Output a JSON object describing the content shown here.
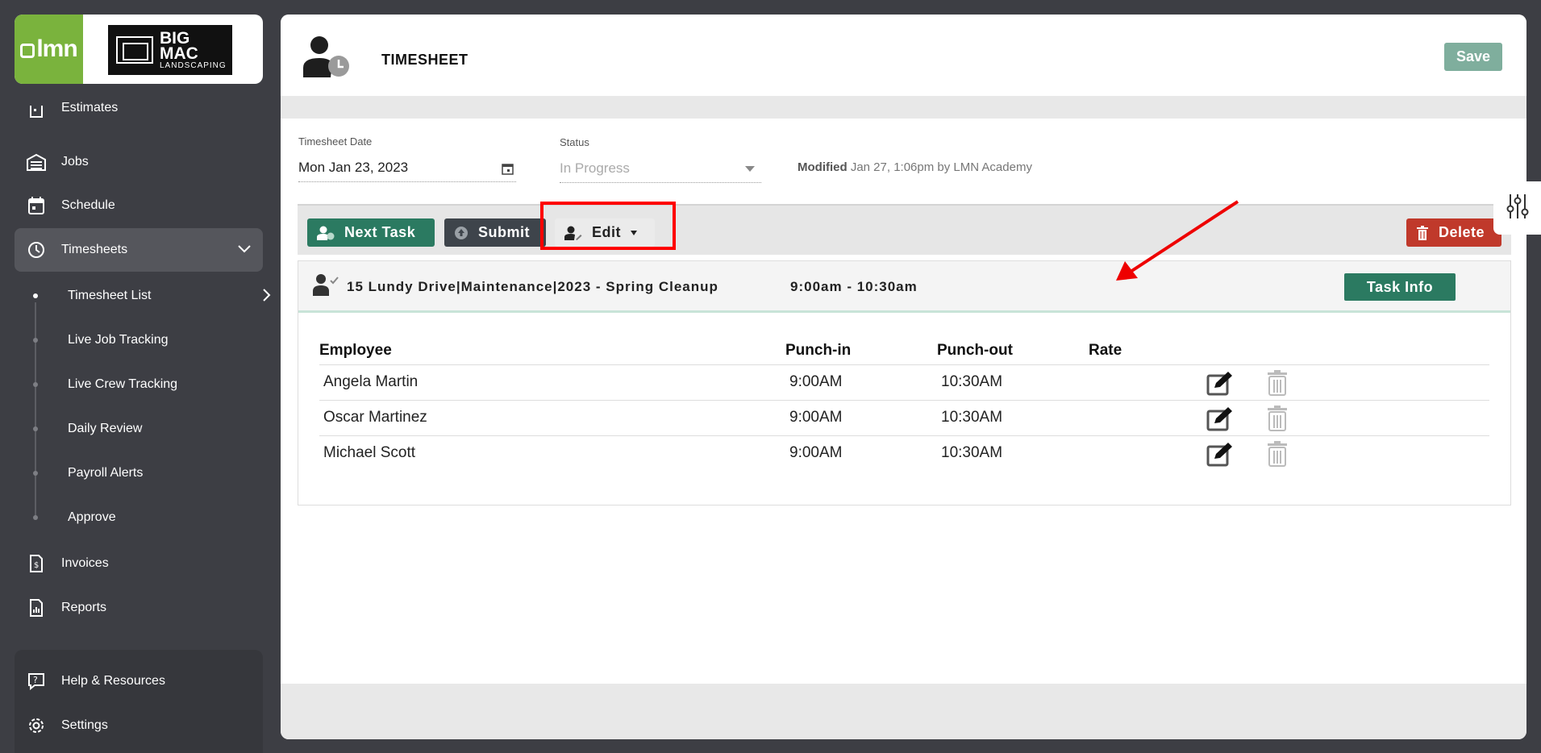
{
  "sidebar": {
    "logo_text": "lmn",
    "company_logo": {
      "line1": "BIG",
      "line2": "MAC",
      "line3": "LANDSCAPING"
    },
    "items": [
      {
        "label": "Estimates",
        "icon": "calculator-icon"
      },
      {
        "label": "Jobs",
        "icon": "garage-icon"
      },
      {
        "label": "Schedule",
        "icon": "calendar-icon"
      },
      {
        "label": "Timesheets",
        "icon": "clock-icon",
        "active": true
      }
    ],
    "subitems": [
      {
        "label": "Timesheet List"
      },
      {
        "label": "Live Job Tracking"
      },
      {
        "label": "Live Crew Tracking"
      },
      {
        "label": "Daily Review"
      },
      {
        "label": "Payroll Alerts"
      },
      {
        "label": "Approve"
      }
    ],
    "bottom_items": [
      {
        "label": "Invoices",
        "icon": "invoice-icon"
      },
      {
        "label": "Reports",
        "icon": "report-icon"
      }
    ],
    "footer_items": [
      {
        "label": "Help & Resources",
        "icon": "help-icon"
      },
      {
        "label": "Settings",
        "icon": "gear-icon"
      }
    ]
  },
  "header": {
    "title": "TIMESHEET",
    "save_label": "Save"
  },
  "form": {
    "date_label": "Timesheet Date",
    "date_value": "Mon Jan 23, 2023",
    "status_label": "Status",
    "status_value": "In Progress",
    "modified_label": "Modified",
    "modified_text": "Jan 27, 1:06pm by LMN Academy"
  },
  "toolbar": {
    "next_task_label": "Next Task",
    "submit_label": "Submit",
    "edit_label": "Edit",
    "delete_label": "Delete"
  },
  "task": {
    "title": "15 Lundy Drive|Maintenance|2023 - Spring Cleanup",
    "time": "9:00am - 10:30am",
    "info_label": "Task Info"
  },
  "table": {
    "headers": [
      "Employee",
      "Punch-in",
      "Punch-out",
      "Rate"
    ],
    "rows": [
      {
        "employee": "Angela Martin",
        "punch_in": "9:00AM",
        "punch_out": "10:30AM",
        "rate": ""
      },
      {
        "employee": "Oscar Martinez",
        "punch_in": "9:00AM",
        "punch_out": "10:30AM",
        "rate": ""
      },
      {
        "employee": "Michael Scott",
        "punch_in": "9:00AM",
        "punch_out": "10:30AM",
        "rate": ""
      }
    ]
  },
  "colors": {
    "sidebar_bg": "#3d3e44",
    "brand_green": "#7ab33d",
    "primary_green": "#2b7a61",
    "save_green": "#7fae9d",
    "delete_red": "#c0392b",
    "highlight_red": "#ff0000"
  }
}
